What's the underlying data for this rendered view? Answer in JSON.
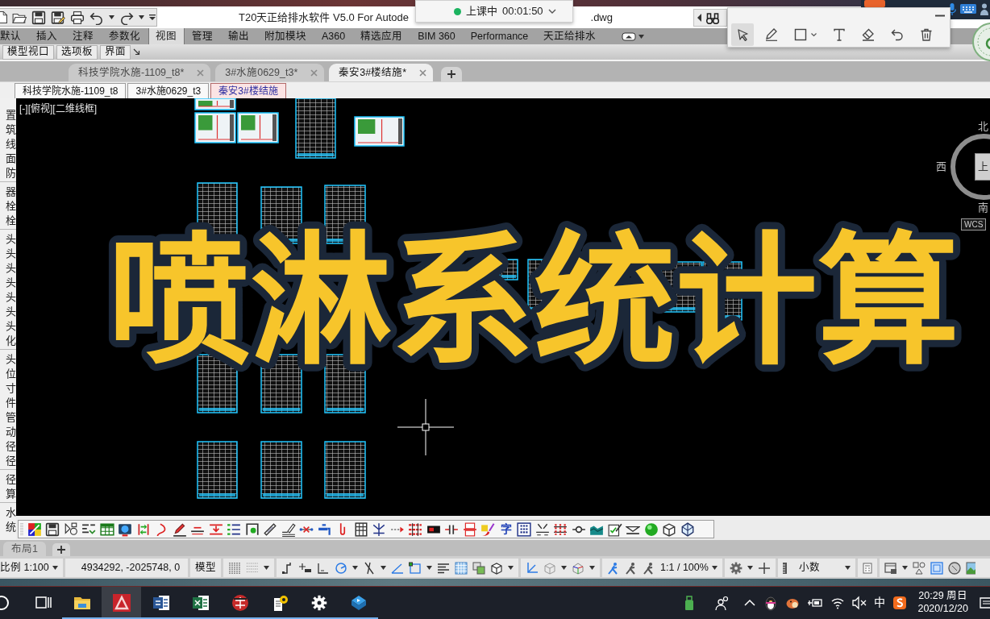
{
  "title_bar": {
    "title": "T20天正给排水软件 V5.0 For Autode",
    "title_end": ".dwg"
  },
  "class_timer": {
    "status": "上课中",
    "time": "00:01:50"
  },
  "annotation_tools": [
    {
      "kind": "pointer",
      "selected": true
    },
    {
      "kind": "pen",
      "selected": false
    },
    {
      "kind": "rectangle",
      "selected": false
    },
    {
      "kind": "text",
      "selected": false
    },
    {
      "kind": "eraser",
      "selected": false
    },
    {
      "kind": "undo",
      "selected": false
    },
    {
      "kind": "trash",
      "selected": false
    }
  ],
  "ribbon": {
    "tabs": [
      {
        "label": "默认",
        "selected": false
      },
      {
        "label": "插入",
        "selected": false
      },
      {
        "label": "注释",
        "selected": false
      },
      {
        "label": "参数化",
        "selected": false
      },
      {
        "label": "视图",
        "selected": true
      },
      {
        "label": "管理",
        "selected": false
      },
      {
        "label": "输出",
        "selected": false
      },
      {
        "label": "附加模块",
        "selected": false
      },
      {
        "label": "A360",
        "selected": false
      },
      {
        "label": "精选应用",
        "selected": false
      },
      {
        "label": "BIM 360",
        "selected": false
      },
      {
        "label": "Performance",
        "selected": false
      },
      {
        "label": "天正给排水",
        "selected": false
      }
    ],
    "panel_buttons": [
      "模型视口",
      "选项板",
      "界面"
    ]
  },
  "file_tabs": [
    {
      "label": "科技学院水施-1109_t8*",
      "selected": false
    },
    {
      "label": "3#水施0629_t3*",
      "selected": false
    },
    {
      "label": "秦安3#楼结施*",
      "selected": true
    }
  ],
  "drawing_tabs": [
    {
      "label": "科技学院水施-1109_t8",
      "selected": false
    },
    {
      "label": "3#水施0629_t3",
      "selected": false
    },
    {
      "label": "秦安3#楼结施",
      "selected": true
    }
  ],
  "sidebar": {
    "groups": [
      [
        "置",
        "筑",
        "线",
        "面",
        "防"
      ],
      [
        "器",
        "栓",
        "栓"
      ],
      [
        "头",
        "头",
        "头",
        "头",
        "头",
        "头",
        "头",
        "化"
      ],
      [
        "头",
        "位",
        "寸",
        "件",
        "管",
        "动",
        "径",
        "径"
      ],
      [
        "径",
        "算"
      ],
      [
        "水",
        "统"
      ]
    ]
  },
  "canvas": {
    "view_label": "[-][俯视][二维线框]",
    "compass": {
      "north": "北",
      "west": "西",
      "south": "南",
      "top": "上",
      "ucs": "WCS"
    }
  },
  "video_title": "喷淋系统计算",
  "bottom_toolbar": {
    "glyph_button": "字"
  },
  "layout_tabs": [
    "布局1"
  ],
  "status_bar": {
    "scale": "比例 1:100",
    "coordinates": "4934292, -2025748, 0",
    "space": "模型",
    "annotation_scale": "1:1 / 100%",
    "units": "小数"
  },
  "taskbar": {
    "apps": [
      {
        "kind": "explorer",
        "selected": false,
        "open": true
      },
      {
        "kind": "cad",
        "selected": true,
        "open": true
      },
      {
        "kind": "word",
        "selected": false,
        "open": true
      },
      {
        "kind": "excel",
        "selected": false,
        "open": true
      },
      {
        "kind": "badge",
        "selected": false,
        "open": true
      },
      {
        "kind": "help",
        "selected": false,
        "open": true
      },
      {
        "kind": "settings",
        "selected": false,
        "open": true
      },
      {
        "kind": "player",
        "selected": false,
        "open": true
      }
    ],
    "ime": "中",
    "time": "20:29 周日",
    "date": "2020/12/20"
  }
}
